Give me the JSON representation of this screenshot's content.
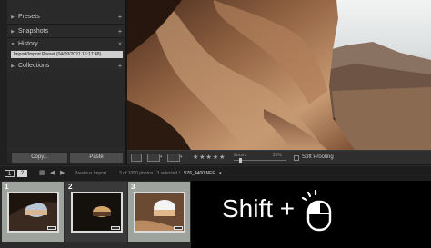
{
  "left_panel": {
    "panels": [
      {
        "label": "Presets",
        "button": "+"
      },
      {
        "label": "Snapshots",
        "button": "+"
      },
      {
        "label": "History",
        "button": "×"
      },
      {
        "label": "Collections",
        "button": "+"
      }
    ],
    "history_entry": "Import/Import Preset (04/09/2021 16:17:48)",
    "copy_label": "Copy...",
    "paste_label": "Paste"
  },
  "toolbar": {
    "stars": "★★★★★",
    "zoom_label": "Zoom",
    "zoom_value": "25%",
    "zoom_fraction": 0.12,
    "soft_proofing_label": "Soft Proofing"
  },
  "filmstrip_bar": {
    "screen1": "1",
    "screen2": "2",
    "source": "Previous Import",
    "status": "3 of 1050 photos / 3 selected /",
    "filename": "VZ6_4400.NEF",
    "dropdown": "▾"
  },
  "filmstrip": {
    "cells": [
      {
        "number": "1",
        "selected": true
      },
      {
        "number": "2",
        "selected": false
      },
      {
        "number": "3",
        "selected": true
      }
    ]
  },
  "overlay": {
    "shortcut_text": "Shift +"
  },
  "colors": {
    "selected_cell": "#9fa39e",
    "unselected_cell": "#393939",
    "selected_thumb_bg": "#bcd7b6"
  }
}
